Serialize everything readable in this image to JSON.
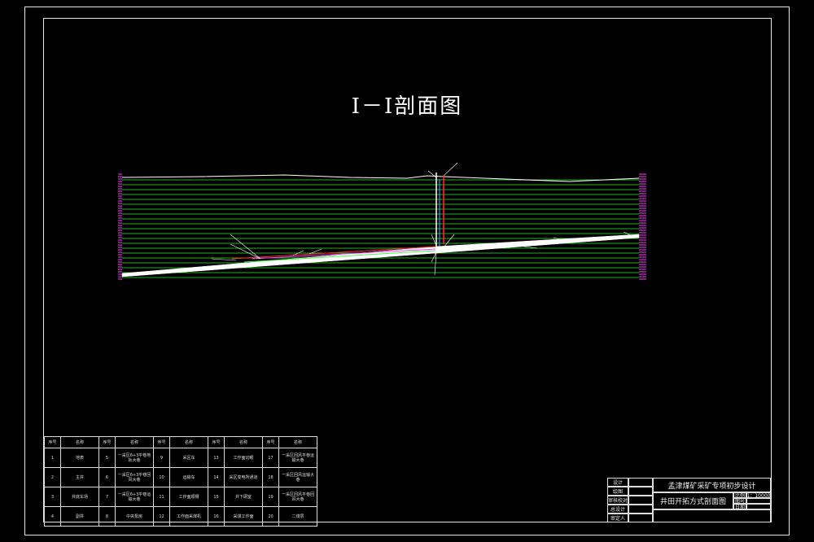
{
  "drawing": {
    "title": "Ⅰ－Ⅰ剖面图"
  },
  "legend": {
    "headers": [
      "序号",
      "名称",
      "序号",
      "名称",
      "序号",
      "名称",
      "序号",
      "名称",
      "序号",
      "名称"
    ],
    "rows": [
      [
        "1",
        "地表",
        "5",
        "一采区6+3平巷地轨大巷",
        "9",
        "采区车",
        "13",
        "工作面切眼",
        "17",
        "一采区回风平巷运输大巷"
      ],
      [
        "2",
        "主井",
        "6",
        "一采区6+3平巷回风大巷",
        "10",
        "运输车",
        "14",
        "采区变电所通道",
        "18",
        "一采区回风运输大巷"
      ],
      [
        "3",
        "井底车场",
        "7",
        "一采区6+3平巷运输大巷",
        "11",
        "工作面顺槽",
        "15",
        "井下硐室",
        "19",
        "一采区回风平巷回风大巷"
      ],
      [
        "4",
        "副井",
        "8",
        "中央泵房",
        "12",
        "工作面采煤机",
        "16",
        "采煤工作面",
        "20",
        "二煤层"
      ]
    ]
  },
  "title_block": {
    "labels": [
      "设计",
      "绘图",
      "审核校对",
      "总设计",
      "审定人"
    ],
    "project": "孟津煤矿采矿专项初步设计",
    "drawing_name": "井田开拓方式剖面图",
    "scale_label": "比例",
    "scale_value": "1：10000",
    "no_label": "图号",
    "date_label": "日期"
  }
}
